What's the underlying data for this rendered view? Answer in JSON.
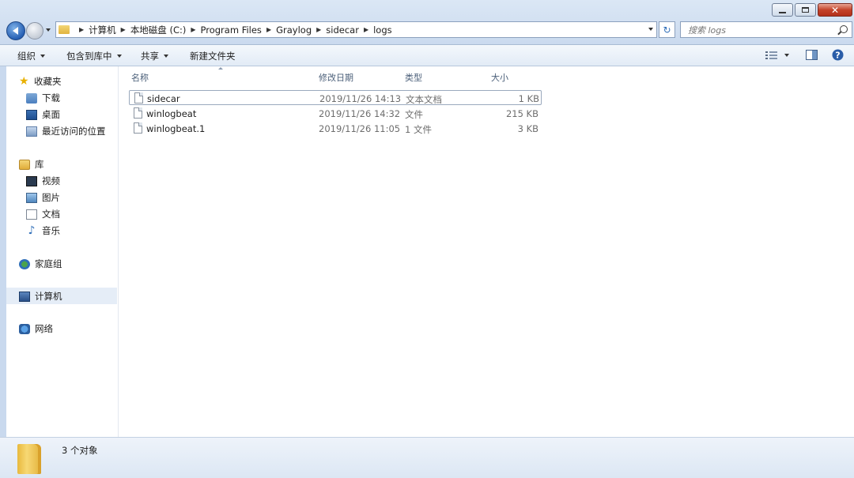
{
  "address_bar": {
    "breadcrumbs": [
      "计算机",
      "本地磁盘 (C:)",
      "Program Files",
      "Graylog",
      "sidecar",
      "logs"
    ]
  },
  "search": {
    "placeholder": "搜索 logs"
  },
  "toolbar": {
    "organize": "组织",
    "include_in_library": "包含到库中",
    "share": "共享",
    "new_folder": "新建文件夹"
  },
  "nav_pane": {
    "favorites": {
      "label": "收藏夹",
      "items": [
        "下载",
        "桌面",
        "最近访问的位置"
      ]
    },
    "libraries": {
      "label": "库",
      "items": [
        "视频",
        "图片",
        "文档",
        "音乐"
      ]
    },
    "homegroup": "家庭组",
    "computer": "计算机",
    "network": "网络"
  },
  "columns": {
    "name": "名称",
    "date": "修改日期",
    "type": "类型",
    "size": "大小"
  },
  "files": [
    {
      "name": "sidecar",
      "date": "2019/11/26 14:13",
      "type": "文本文档",
      "size": "1 KB"
    },
    {
      "name": "winlogbeat",
      "date": "2019/11/26 14:32",
      "type": "文件",
      "size": "215 KB"
    },
    {
      "name": "winlogbeat.1",
      "date": "2019/11/26 11:05",
      "type": "1 文件",
      "size": "3 KB"
    }
  ],
  "status": {
    "count_text": "3 个对象"
  }
}
